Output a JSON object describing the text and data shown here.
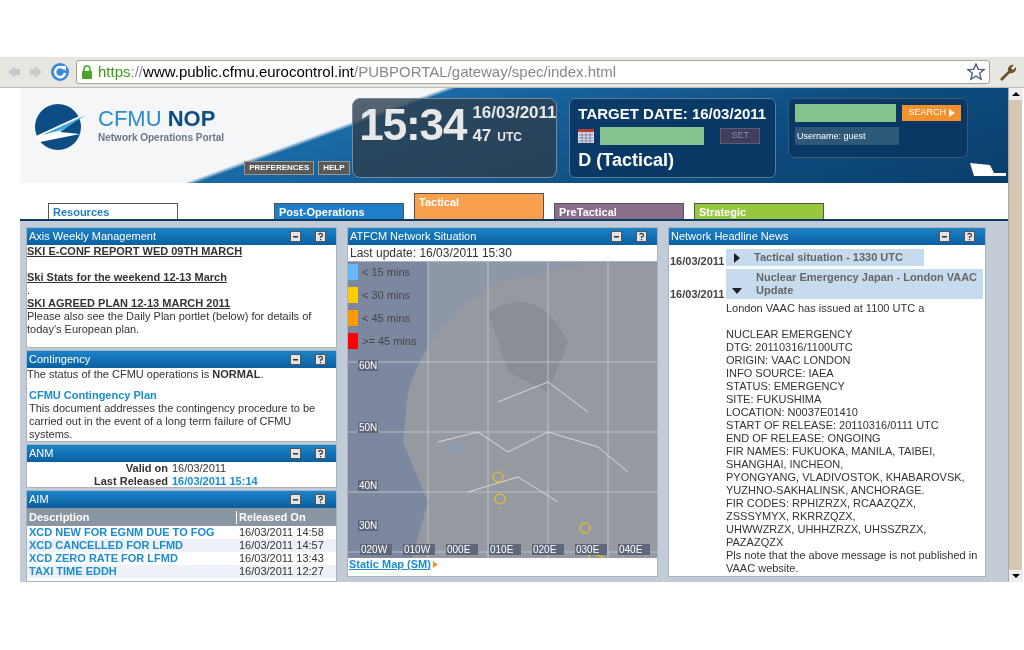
{
  "browser": {
    "url_parts": [
      {
        "kind": "scheme",
        "text": "https"
      },
      {
        "kind": "sep",
        "text": "://"
      },
      {
        "kind": "host",
        "text": "www.public.cfmu.eurocontrol.int"
      },
      {
        "kind": "path",
        "text": "/PUBPORTAL/gateway/spec/index.html"
      }
    ]
  },
  "header": {
    "brand": "CFMU",
    "brand_bold": "NOP",
    "subtitle": "Network Operations Portal",
    "buttons": [
      "PREFERENCES",
      "HELP"
    ],
    "clock": {
      "time": "15:34",
      "date": "16/03/2011",
      "seconds": "47",
      "zone": "UTC"
    },
    "target": {
      "title": "TARGET DATE: 16/03/2011",
      "set_button": "SET",
      "mode": "D (Tactical)"
    },
    "login": {
      "search_button": "SEARCH",
      "username": "Username: guest"
    }
  },
  "tabs": [
    {
      "label": "Resources",
      "color": "#ffffff",
      "selected": false
    },
    {
      "label": "Post-Operations",
      "color": "#1e7fc8",
      "selected": false
    },
    {
      "label": "Tactical",
      "color": "#f9a04e",
      "selected": true
    },
    {
      "label": "PreTactical",
      "color": "#8a6f8c",
      "selected": false
    },
    {
      "label": "Strategic",
      "color": "#95c83c",
      "selected": false
    }
  ],
  "axis": {
    "title": "Axis Weekly Management",
    "links": [
      "SKI E-CONF REPORT WED 09TH MARCH",
      "Ski Stats for the weekend 12-13 March",
      "SKI AGREED PLAN 12-13 MARCH 2011"
    ],
    "dot": ".",
    "note": "Please also see the Daily Plan portlet (below) for details of today's European plan."
  },
  "contingency": {
    "title": "Contingency",
    "status": "The status of the CFMU operations is **NORMAL**.",
    "plan_link": "CFMU Contingency Plan",
    "plan_text": "This document addresses the contingency procedure to be carried out in the event of a long term failure of CFMU systems."
  },
  "anm": {
    "title": "ANM",
    "valid_label": "Valid on",
    "valid_value": "16/03/2011",
    "released_label": "Last Released",
    "released_value": "16/03/2011 15:14"
  },
  "aim": {
    "title": "AIM",
    "columns": [
      "Description",
      "Released On"
    ],
    "rows": [
      {
        "description": "XCD NEW FOR EGNM DUE TO FOG",
        "released": "16/03/2011 14:58"
      },
      {
        "description": "XCD CANCELLED FOR LFMD",
        "released": "16/03/2011 14:57"
      },
      {
        "description": "XCD ZERO RATE FOR LFMD",
        "released": "16/03/2011 13:43"
      },
      {
        "description": "TAXI TIME EDDH",
        "released": "16/03/2011 12:27"
      }
    ]
  },
  "atfcm": {
    "title": "ATFCM Network Situation",
    "last_update": "Last update: 16/03/2011 15:30",
    "legend": [
      {
        "label": "< 15 mins",
        "color": "#66b8ff"
      },
      {
        "label": "< 30 mins",
        "color": "#ffcc00"
      },
      {
        "label": "< 45 mins",
        "color": "#ff9900"
      },
      {
        "label": ">= 45 mins",
        "color": "#ff0000"
      }
    ],
    "lat_labels": [
      "60N",
      "50N",
      "40N",
      "30N"
    ],
    "lon_labels": [
      "020W",
      "010W",
      "000E",
      "010E",
      "020E",
      "030E",
      "040E"
    ],
    "static_link": "Static Map (SM)"
  },
  "news": {
    "title": "Network Headline News",
    "items": [
      {
        "date": "16/03/2011",
        "headline": "Tactical situation - 1330 UTC",
        "expanded": false
      },
      {
        "date": "16/03/2011",
        "headline": "Nuclear Emergency Japan - London VAAC Update",
        "expanded": true,
        "body": [
          [
            "London VAAC has issued at 1100 UTC a"
          ],
          [
            "NUCLEAR EMERGENCY",
            "DTG: 20110316/1100UTC",
            "ORIGIN: VAAC LONDON",
            "INFO SOURCE: IAEA",
            "STATUS: EMERGENCY",
            "SITE: FUKUSHIMA",
            "LOCATION: N0037E01410",
            "START OF RELEASE: 20110316/0111 UTC",
            "END OF RELEASE: ONGOING",
            "FIR NAMES: FUKUOKA, MANILA, TAIBEI, SHANGHAI, INCHEON,",
            "PYONGYANG, VLADIVOSTOK, KHABAROVSK, YUZHNO-SAKHALINSK, ANCHORAGE.",
            "FIR CODES: RPHIZRZX, RCAAZQZX, ZSSSYMYX, RKRRZQZX,",
            "UHWWZRZX, UHHHZRZX, UHSSZRZX, PAZAZQZX",
            "Pls note that the above message is not published in VAAC website."
          ]
        ]
      }
    ]
  }
}
